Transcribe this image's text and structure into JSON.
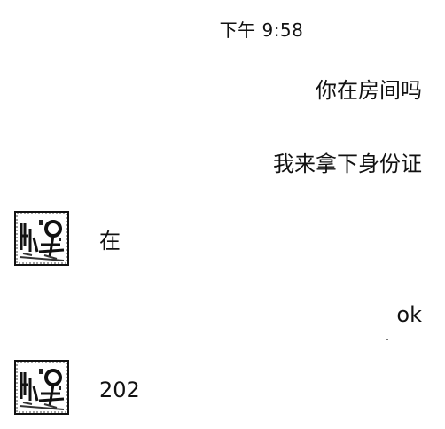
{
  "chat": {
    "timestamp": "下午 9:58",
    "messages": [
      {
        "side": "out",
        "text": "你在房间吗"
      },
      {
        "side": "out",
        "text": "我来拿下身份证"
      },
      {
        "side": "in",
        "text": "在",
        "avatar": "contact-avatar"
      },
      {
        "side": "out",
        "text": "ok"
      },
      {
        "side": "in",
        "text": "202",
        "avatar": "contact-avatar"
      }
    ]
  }
}
